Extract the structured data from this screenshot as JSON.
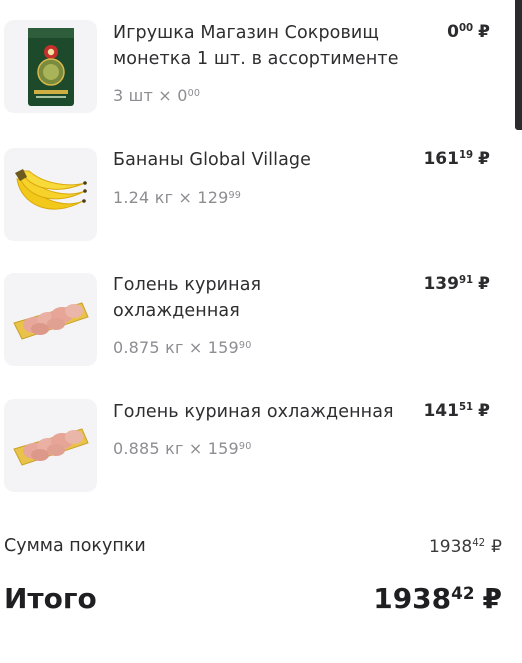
{
  "currency": "₽",
  "items": [
    {
      "name": "Игрушка Магазин Сокровищ монетка 1 шт. в ассортименте",
      "qty_prefix": "3 шт × ",
      "qty_rub": "0",
      "qty_kop": "00",
      "price_rub": "0",
      "price_kop": "00",
      "image_icon": "toy-package-icon"
    },
    {
      "name": "Бананы Global Village",
      "qty_prefix": "1.24 кг × ",
      "qty_rub": "129",
      "qty_kop": "99",
      "price_rub": "161",
      "price_kop": "19",
      "image_icon": "bananas-icon"
    },
    {
      "name": "Голень куриная охлажденная",
      "qty_prefix": "0.875 кг × ",
      "qty_rub": "159",
      "qty_kop": "90",
      "price_rub": "139",
      "price_kop": "91",
      "image_icon": "chicken-tray-icon"
    },
    {
      "name": "Голень куриная охлажденная",
      "qty_prefix": "0.885 кг × ",
      "qty_rub": "159",
      "qty_kop": "90",
      "price_rub": "141",
      "price_kop": "51",
      "image_icon": "chicken-tray-icon"
    }
  ],
  "summary": {
    "subtotal_label": "Сумма покупки",
    "subtotal_rub": "1938",
    "subtotal_kop": "42",
    "total_label": "Итого",
    "total_rub": "1938",
    "total_kop": "42"
  }
}
